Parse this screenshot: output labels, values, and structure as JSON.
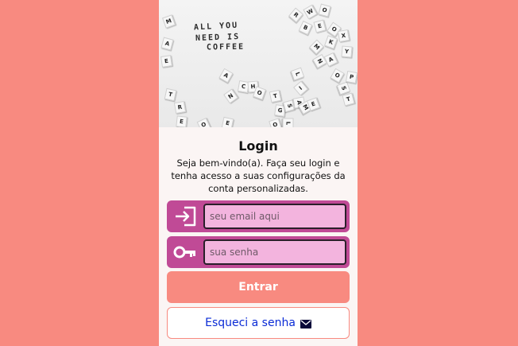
{
  "hero": {
    "phrase_line1": "ALL YOU",
    "phrase_line2": "NEED IS",
    "phrase_line3": "COFFEE",
    "background": "#eeeeee"
  },
  "login": {
    "title": "Login",
    "description": "Seja bem-vindo(a). Faça seu login e tenha acesso a suas configurações da conta personalizadas."
  },
  "email": {
    "icon": "login-icon",
    "value": "",
    "placeholder": "seu email aqui"
  },
  "password": {
    "icon": "key-icon",
    "value": "",
    "placeholder": "sua senha"
  },
  "actions": {
    "submit_label": "Entrar",
    "forgot_label": "Esqueci a senha",
    "forgot_icon": "mail-icon"
  },
  "colors": {
    "page_background": "#f88a80",
    "card_background": "#fbf5f4",
    "field_accent": "#c04a96",
    "input_fill": "#f3b4de",
    "submit_button": "#f88a80",
    "forgot_text": "#0a2bd6"
  }
}
